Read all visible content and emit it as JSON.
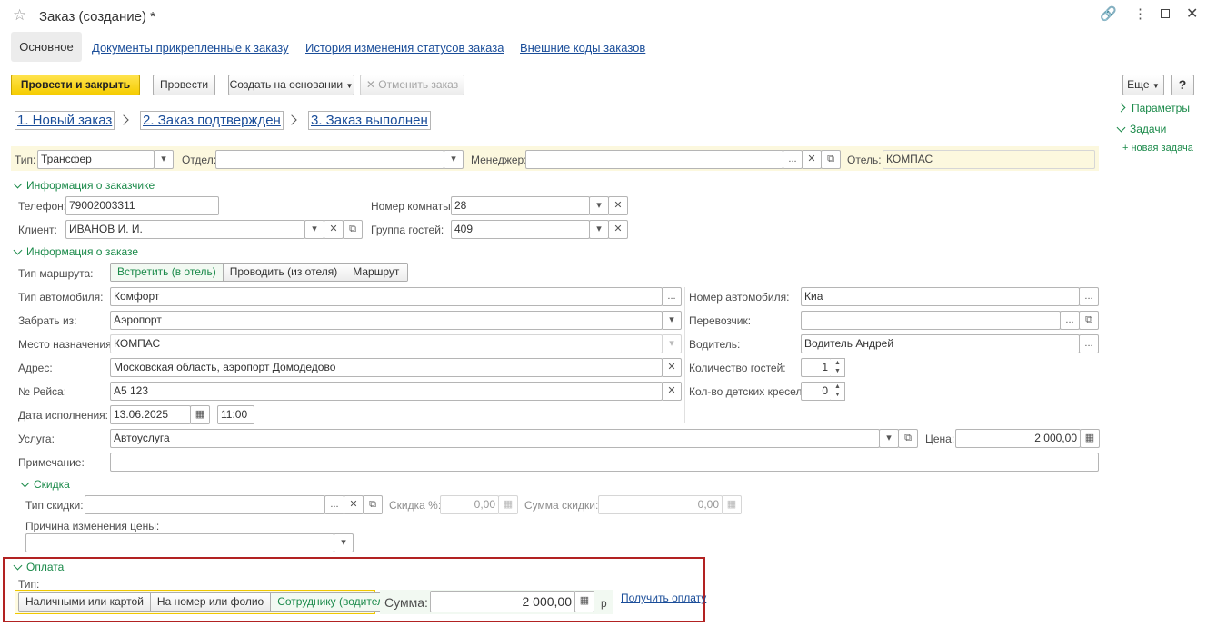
{
  "window": {
    "title": "Заказ (создание) *"
  },
  "tabs": [
    "Основное",
    "Документы прикрепленные к заказу",
    "История изменения статусов заказа",
    "Внешние коды заказов"
  ],
  "toolbar": {
    "post_close": "Провести и закрыть",
    "post": "Провести",
    "create_based": "Создать на основании",
    "cancel_order": "Отменить заказ",
    "more": "Еще",
    "help": "?"
  },
  "steps": [
    "1. Новый заказ",
    "2. Заказ подтвержден",
    "3. Заказ выполнен"
  ],
  "side_panel": {
    "params": "Параметры",
    "tasks": "Задачи",
    "new_task": "+ новая задача"
  },
  "header": {
    "type_label": "Тип:",
    "type_value": "Трансфер",
    "dept_label": "Отдел:",
    "dept_value": "",
    "manager_label": "Менеджер:",
    "manager_value": "",
    "hotel_label": "Отель:",
    "hotel_value": "КОМПАС"
  },
  "customer": {
    "title": "Информация о заказчике",
    "phone_label": "Телефон:",
    "phone": "79002003311",
    "client_label": "Клиент:",
    "client": "ИВАНОВ И. И.",
    "room_label": "Номер комнаты:",
    "room": "28",
    "guest_group_label": "Группа гостей:",
    "guest_group": "409"
  },
  "order": {
    "title": "Информация о заказе",
    "route_label": "Тип маршрута:",
    "route_options": [
      "Встретить (в отель)",
      "Проводить (из отеля)",
      "Маршрут"
    ],
    "car_type_label": "Тип автомобиля:",
    "car_type": "Комфорт",
    "pickup_label": "Забрать из:",
    "pickup": "Аэропорт",
    "dest_label": "Место назначения:",
    "dest": "КОМПАС",
    "address_label": "Адрес:",
    "address": "Московская область, аэропорт Домодедово",
    "flight_label": "№ Рейса:",
    "flight": "А5 123",
    "date_label": "Дата исполнения:",
    "date": "13.06.2025",
    "time": "11:00",
    "service_label": "Услуга:",
    "service": "Автоуслуга",
    "price_label": "Цена:",
    "price": "2 000,00",
    "note_label": "Примечание:",
    "note": "",
    "car_number_label": "Номер автомобиля:",
    "car_number": "Киа",
    "carrier_label": "Перевозчик:",
    "carrier": "",
    "driver_label": "Водитель:",
    "driver": "Водитель Андрей",
    "guests_label": "Количество гостей:",
    "guests": "1",
    "child_seats_label": "Кол-во детских кресел:",
    "child_seats": "0"
  },
  "discount": {
    "title": "Скидка",
    "type_label": "Тип скидки:",
    "type": "",
    "percent_label": "Скидка %:",
    "percent": "0,00",
    "sum_label": "Сумма скидки:",
    "sum": "0,00",
    "reason_label": "Причина изменения цены:",
    "reason": ""
  },
  "payment": {
    "title": "Оплата",
    "type_label": "Тип:",
    "types": [
      "Наличными или картой",
      "На номер или фолио",
      "Сотруднику (водителю)"
    ],
    "sum_label": "Сумма:",
    "sum": "2 000,00",
    "currency": "р",
    "get_payment": "Получить оплату"
  },
  "colors": {
    "accent_green": "#1b8a4a",
    "primary_yellow": "#f5cc00",
    "highlight_border": "#b22222",
    "header_bg": "#fcf8de"
  }
}
